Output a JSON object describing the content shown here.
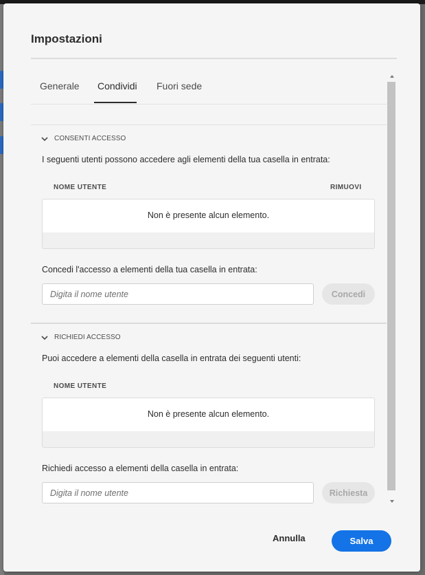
{
  "dialog": {
    "title": "Impostazioni",
    "tabs": [
      {
        "label": "Generale"
      },
      {
        "label": "Condividi"
      },
      {
        "label": "Fuori sede"
      }
    ],
    "active_tab": "Condividi"
  },
  "grant": {
    "section_title": "CONSENTI ACCESSO",
    "description": "I seguenti utenti possono accedere agli elementi della tua casella in entrata:",
    "col_username": "NOME UTENTE",
    "col_remove": "RIMUOVI",
    "empty": "Non è presente alcun elemento.",
    "prompt": "Concedi l'accesso a elementi della tua casella in entrata:",
    "input_placeholder": "Digita il nome utente",
    "button": "Concedi"
  },
  "request": {
    "section_title": "RICHIEDI ACCESSO",
    "description": "Puoi accedere a elementi della casella in entrata dei seguenti utenti:",
    "col_username": "NOME UTENTE",
    "empty": "Non è presente alcun elemento.",
    "prompt": "Richiedi accesso a elementi della casella in entrata:",
    "input_placeholder": "Digita il nome utente",
    "button": "Richiesta"
  },
  "footer": {
    "cancel": "Annulla",
    "save": "Salva"
  },
  "colors": {
    "accent": "#1473e6",
    "dialog_bg": "#f5f5f5",
    "backdrop": "#6b6b6b"
  }
}
